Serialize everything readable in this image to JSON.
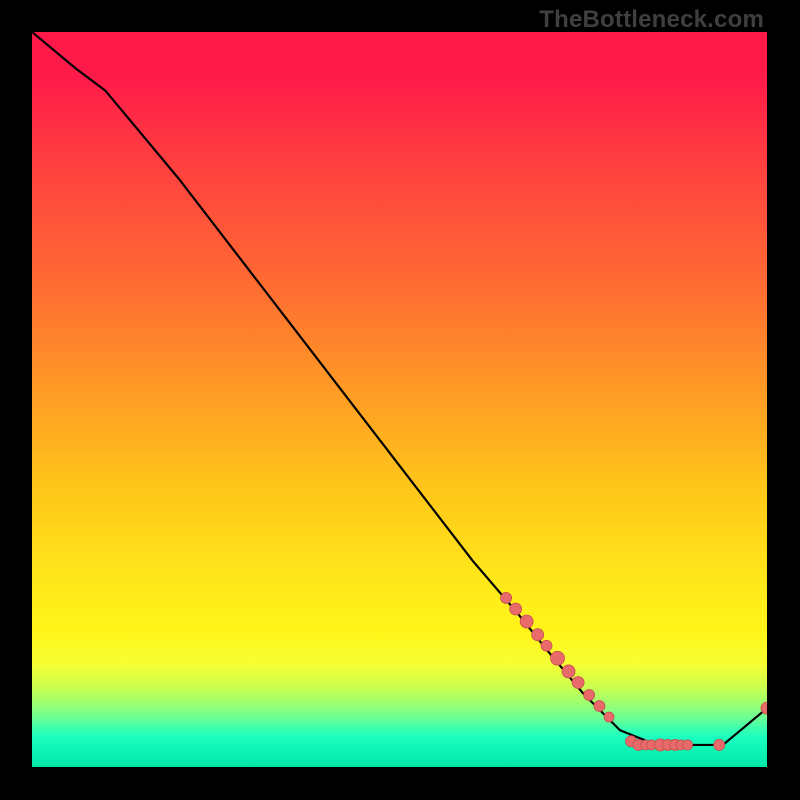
{
  "watermark": "TheBottleneck.com",
  "colors": {
    "line": "#000000",
    "marker_fill": "#e86a6a",
    "marker_stroke": "#c74f4f",
    "background_frame": "#000000"
  },
  "chart_data": {
    "type": "line",
    "title": "",
    "xlabel": "",
    "ylabel": "",
    "xlim": [
      0,
      100
    ],
    "ylim": [
      0,
      100
    ],
    "grid": false,
    "legend": false,
    "series": [
      {
        "name": "curve",
        "x": [
          0,
          6,
          10,
          20,
          30,
          40,
          50,
          60,
          66,
          70,
          75,
          80,
          85,
          90,
          94,
          100
        ],
        "y": [
          100,
          95,
          92,
          80,
          67,
          54,
          41,
          28,
          21,
          16,
          10,
          5,
          3,
          3,
          3,
          8
        ]
      }
    ],
    "markers": [
      {
        "x": 64.5,
        "y": 23.0,
        "r": 5.5
      },
      {
        "x": 65.8,
        "y": 21.5,
        "r": 6.0
      },
      {
        "x": 67.3,
        "y": 19.8,
        "r": 6.5
      },
      {
        "x": 68.8,
        "y": 18.0,
        "r": 6.0
      },
      {
        "x": 70.0,
        "y": 16.5,
        "r": 5.5
      },
      {
        "x": 71.5,
        "y": 14.8,
        "r": 7.0
      },
      {
        "x": 73.0,
        "y": 13.0,
        "r": 6.5
      },
      {
        "x": 74.3,
        "y": 11.5,
        "r": 6.0
      },
      {
        "x": 75.8,
        "y": 9.8,
        "r": 5.5
      },
      {
        "x": 77.2,
        "y": 8.3,
        "r": 5.5
      },
      {
        "x": 78.5,
        "y": 6.8,
        "r": 5.0
      },
      {
        "x": 81.5,
        "y": 3.5,
        "r": 5.5
      },
      {
        "x": 82.5,
        "y": 3.0,
        "r": 5.5
      },
      {
        "x": 83.5,
        "y": 3.0,
        "r": 5.0
      },
      {
        "x": 84.3,
        "y": 3.0,
        "r": 5.0
      },
      {
        "x": 85.5,
        "y": 3.0,
        "r": 6.0
      },
      {
        "x": 86.5,
        "y": 3.0,
        "r": 5.5
      },
      {
        "x": 87.5,
        "y": 3.0,
        "r": 5.5
      },
      {
        "x": 88.3,
        "y": 3.0,
        "r": 5.0
      },
      {
        "x": 89.2,
        "y": 3.0,
        "r": 5.0
      },
      {
        "x": 93.5,
        "y": 3.0,
        "r": 5.5
      },
      {
        "x": 100.0,
        "y": 8.0,
        "r": 6.0
      }
    ]
  }
}
